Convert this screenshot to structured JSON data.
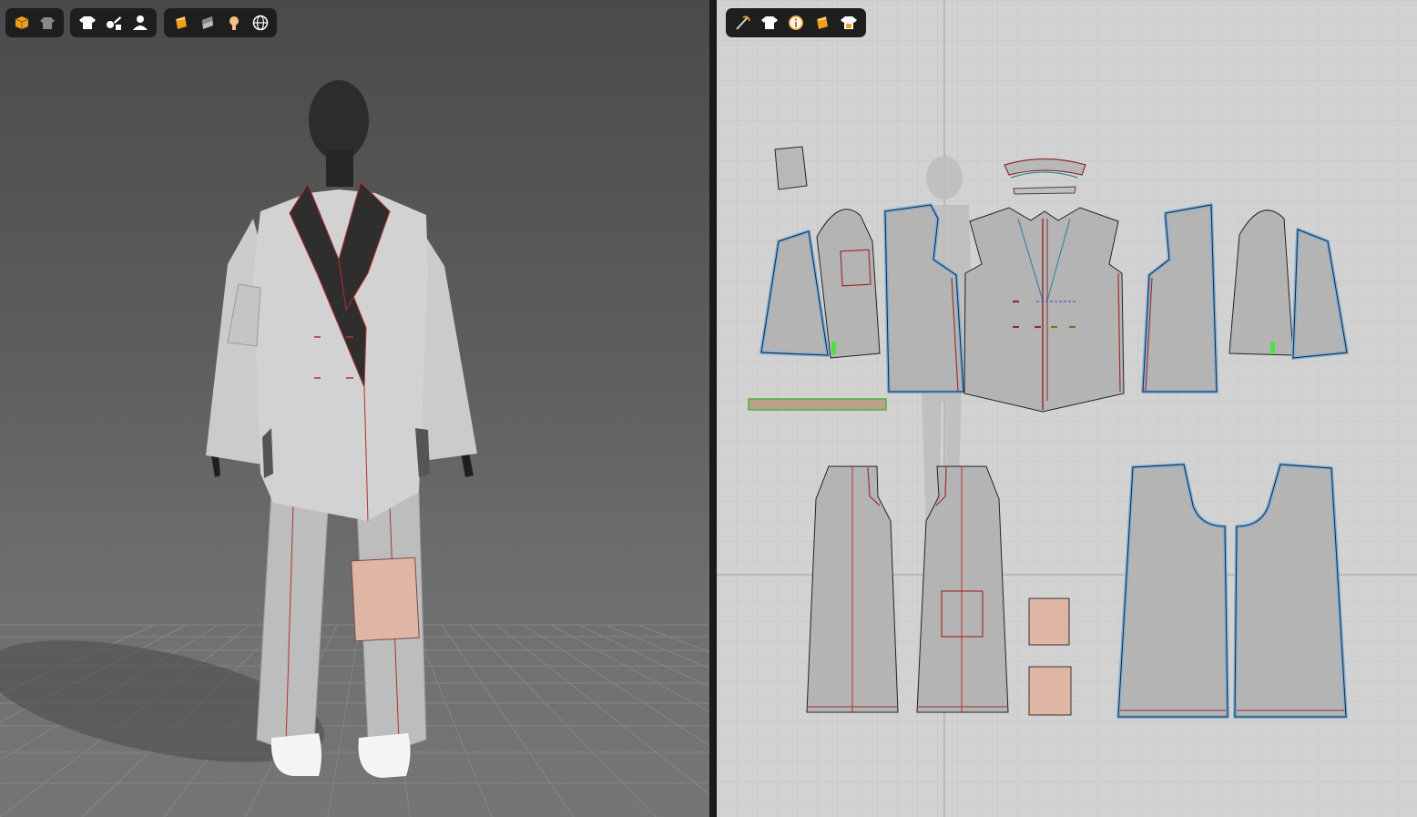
{
  "viewport3d": {
    "toolbar_groups": [
      {
        "id": "display",
        "buttons": [
          {
            "icon": "avatar-box-icon",
            "color": "#f0a020"
          },
          {
            "icon": "garment-display-icon",
            "color": "#bbbbbb"
          }
        ]
      },
      {
        "id": "garment",
        "buttons": [
          {
            "icon": "tshirt-icon",
            "color": "#ffffff"
          },
          {
            "icon": "tools-icon",
            "color": "#ffffff"
          },
          {
            "icon": "avatar-icon",
            "color": "#ffffff"
          }
        ]
      },
      {
        "id": "render",
        "buttons": [
          {
            "icon": "texture-icon",
            "color": "#f0a020"
          },
          {
            "icon": "shading-icon",
            "color": "#cccccc"
          },
          {
            "icon": "skin-icon",
            "color": "#f3c08a"
          },
          {
            "icon": "globe-icon",
            "color": "#ffffff"
          }
        ]
      }
    ]
  },
  "viewport2d": {
    "toolbar_buttons": [
      {
        "icon": "pattern-tool-icon",
        "color": "#f0a020"
      },
      {
        "icon": "tshirt-icon",
        "color": "#ffffff"
      },
      {
        "icon": "info-icon",
        "color": "#f0a020"
      },
      {
        "icon": "texture-icon",
        "color": "#f0a020"
      },
      {
        "icon": "garment-lock-icon",
        "color": "#ffffff"
      }
    ]
  },
  "colors": {
    "fabric_gray": "#c7c7c7",
    "pattern_fill": "#b4b4b4",
    "seam_red": "#b03030",
    "selected_outline": "#7ab0e0",
    "pocket_pink": "#dfb6a5",
    "lapel_dark": "#2e2e2e",
    "trim_green": "#52b040"
  }
}
